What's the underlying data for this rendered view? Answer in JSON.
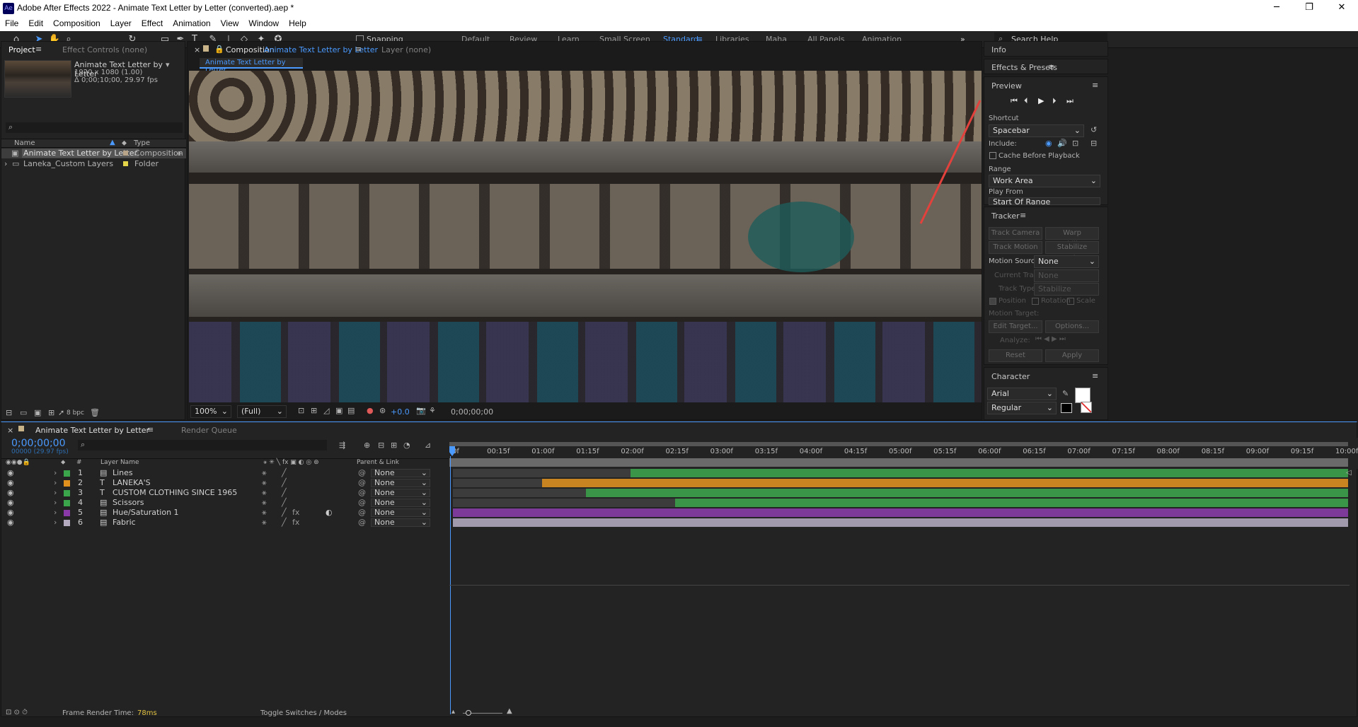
{
  "window": {
    "title": "Adobe After Effects 2022 - Animate Text Letter by Letter (converted).aep *",
    "app_icon": "Ae"
  },
  "menu": [
    "File",
    "Edit",
    "Composition",
    "Layer",
    "Effect",
    "Animation",
    "View",
    "Window",
    "Help"
  ],
  "toolbar": {
    "snapping": "Snapping",
    "workspaces": [
      "Default",
      "Review",
      "Learn",
      "Small Screen",
      "Standard",
      "Libraries",
      "Maha",
      "All Panels",
      "Animation"
    ],
    "active_workspace": "Standard",
    "search_help": "Search Help"
  },
  "project": {
    "tab": "Project",
    "effect_controls": "Effect Controls (none)",
    "comp_name": "Animate Text Letter by Letter",
    "comp_res": "1920 x 1080 (1.00)",
    "comp_duration": "Δ 0;00;10;00, 29.97 fps",
    "col_name": "Name",
    "col_type": "Type",
    "items": [
      {
        "name": "Animate Text Letter by Letter",
        "type": "Composition"
      },
      {
        "name": "Laneka_Custom Layers",
        "type": "Folder"
      }
    ],
    "bpc": "8 bpc"
  },
  "composition": {
    "tab_prefix": "Composition",
    "tab_name": "Animate Text Letter by Letter",
    "layer_tab": "Layer (none)",
    "flow_tab": "Animate Text Letter by Letter",
    "zoom": "100%",
    "resolution": "(Full)",
    "exposure": "+0.0",
    "timecode": "0;00;00;00"
  },
  "right": {
    "info": "Info",
    "effects_presets": "Effects & Presets",
    "preview": "Preview",
    "shortcut_label": "Shortcut",
    "shortcut_value": "Spacebar",
    "include": "Include:",
    "cache": "Cache Before Playback",
    "range_label": "Range",
    "range_value": "Work Area",
    "play_from_label": "Play From",
    "play_from_value": "Start Of Range",
    "tracker": "Tracker",
    "track_camera": "Track Camera",
    "warp_stabilizer": "Warp Stabilizer",
    "track_motion": "Track Motion",
    "stabilize_motion": "Stabilize Motion",
    "motion_source": "Motion Source:",
    "motion_source_value": "None",
    "current_track": "Current Track:",
    "current_track_value": "None",
    "track_type": "Track Type:",
    "track_type_value": "Stabilize",
    "position": "Position",
    "rotation": "Rotation",
    "scale": "Scale",
    "motion_target": "Motion Target:",
    "edit_target": "Edit Target...",
    "options": "Options...",
    "analyze": "Analyze:",
    "reset": "Reset",
    "apply": "Apply",
    "character": "Character",
    "font": "Arial",
    "style": "Regular"
  },
  "timeline": {
    "tab": "Animate Text Letter by Letter",
    "render_queue": "Render Queue",
    "timecode": "0;00;00;00",
    "frames": "00000 (29.97 fps)",
    "layer_name_header": "Layer Name",
    "parent_header": "Parent & Link",
    "ruler": [
      "0f",
      "00:15f",
      "01:00f",
      "01:15f",
      "02:00f",
      "02:15f",
      "03:00f",
      "03:15f",
      "04:00f",
      "04:15f",
      "05:00f",
      "05:15f",
      "06:00f",
      "06:15f",
      "07:00f",
      "07:15f",
      "08:00f",
      "08:15f",
      "09:00f",
      "09:15f",
      "10:00f"
    ],
    "layers": [
      {
        "num": "1",
        "name": "Lines",
        "type": "shape",
        "color": "#3aa54a",
        "parent": "None",
        "start": 2.0
      },
      {
        "num": "2",
        "name": "LANEKA'S",
        "type": "text",
        "color": "#e0901c",
        "parent": "None",
        "start": 1.0
      },
      {
        "num": "3",
        "name": "CUSTOM CLOTHING  SINCE 1965",
        "type": "text",
        "color": "#3aa54a",
        "parent": "None",
        "start": 1.5
      },
      {
        "num": "4",
        "name": "Scissors",
        "type": "shape",
        "color": "#3aa54a",
        "parent": "None",
        "start": 2.5
      },
      {
        "num": "5",
        "name": "Hue/Saturation 1",
        "type": "adjustment",
        "color": "#8a3aa8",
        "parent": "None",
        "start": 0
      },
      {
        "num": "6",
        "name": "Fabric",
        "type": "footage",
        "color": "#b3aac0",
        "parent": "None",
        "start": 0
      }
    ],
    "frame_render_label": "Frame Render Time:",
    "frame_render_value": "78ms",
    "toggle": "Toggle Switches / Modes"
  }
}
